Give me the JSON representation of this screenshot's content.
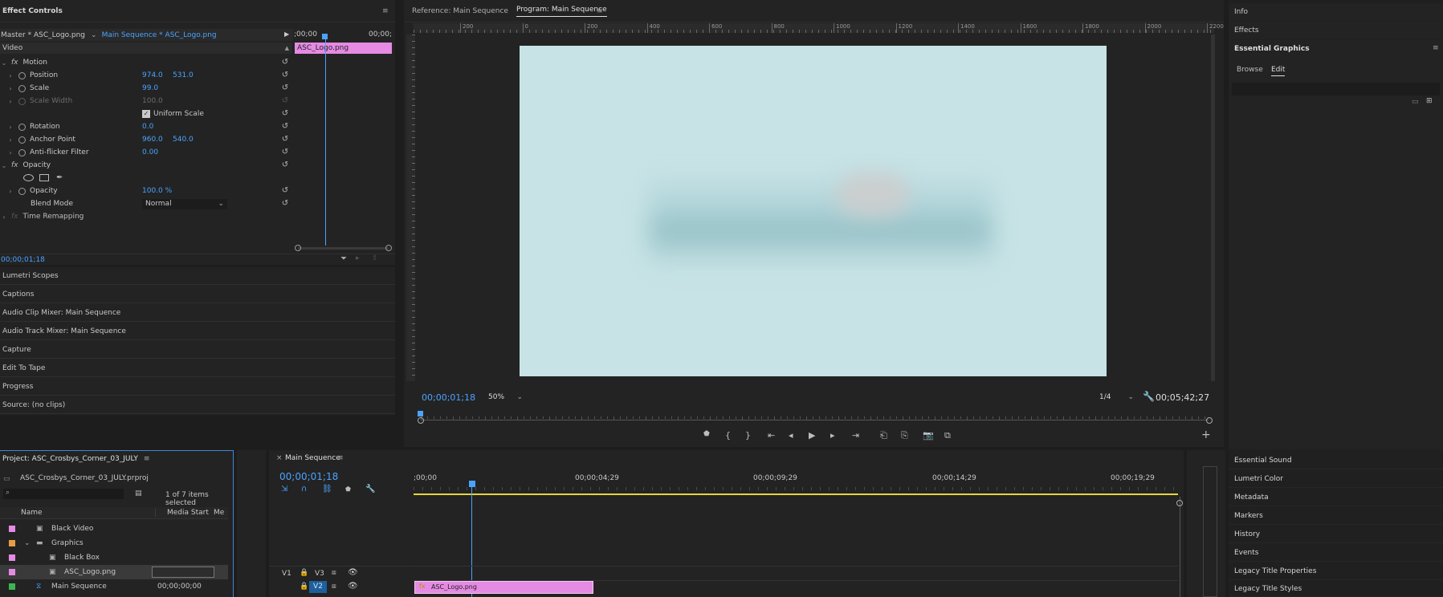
{
  "effect_controls": {
    "title": "Effect Controls",
    "source_master": "Master * ASC_Logo.png",
    "source_sequence": "Main Sequence * ASC_Logo.png",
    "time_start": ";00;00",
    "time_end": "00;00;",
    "clip_label": "ASC_Logo.png",
    "video_label": "Video",
    "motion_label": "Motion",
    "position_label": "Position",
    "position_x": "974.0",
    "position_y": "531.0",
    "scale_label": "Scale",
    "scale_value": "99.0",
    "scale_width_label": "Scale Width",
    "scale_width_value": "100.0",
    "uniform_scale_label": "Uniform Scale",
    "rotation_label": "Rotation",
    "rotation_value": "0.0",
    "anchor_label": "Anchor Point",
    "anchor_x": "960.0",
    "anchor_y": "540.0",
    "antiflicker_label": "Anti-flicker Filter",
    "antiflicker_value": "0.00",
    "opacity_group_label": "Opacity",
    "opacity_label": "Opacity",
    "opacity_value": "100.0 %",
    "blend_label": "Blend Mode",
    "blend_value": "Normal",
    "time_remap_label": "Time Remapping",
    "timecode": "00;00;01;18"
  },
  "left_panels": [
    "Lumetri Scopes",
    "Captions",
    "Audio Clip Mixer: Main Sequence",
    "Audio Track Mixer: Main Sequence",
    "Capture",
    "Edit To Tape",
    "Progress",
    "Source: (no clips)"
  ],
  "program": {
    "tab_reference": "Reference: Main Sequence",
    "tab_program": "Program: Main Sequence",
    "ruler_labels": [
      "200",
      "0",
      "200",
      "400",
      "600",
      "800",
      "1000",
      "1200",
      "1400",
      "1600",
      "1800",
      "2000",
      "2200"
    ],
    "timecode": "00;00;01;18",
    "zoom": "50%",
    "resolution": "1/4",
    "duration": "00;05;42;27"
  },
  "right_panel": {
    "info": "Info",
    "effects": "Effects",
    "essential_graphics": "Essential Graphics",
    "tab_browse": "Browse",
    "tab_edit": "Edit",
    "bottom_items": [
      "Essential Sound",
      "Lumetri Color",
      "Metadata",
      "Markers",
      "History",
      "Events",
      "Legacy Title Properties",
      "Legacy Title Styles"
    ]
  },
  "project": {
    "title": "Project: ASC_Crosbys_Corner_03_JULY",
    "filename": "ASC_Crosbys_Corner_03_JULY.prproj",
    "selection_count": "1 of 7 items selected",
    "col_name": "Name",
    "col_media_start": "Media Start",
    "col_more": "Me",
    "items": [
      {
        "name": "Black Video",
        "color": "#e58be3",
        "start": ""
      },
      {
        "name": "Graphics",
        "color": "#e89c45",
        "start": ""
      },
      {
        "name": "Black Box",
        "color": "#e58be3",
        "start": ""
      },
      {
        "name": "ASC_Logo.png",
        "color": "#e58be3",
        "start": ""
      },
      {
        "name": "Main Sequence",
        "color": "#3bb552",
        "start": "00;00;00;00"
      }
    ]
  },
  "timeline": {
    "tab": "Main Sequence",
    "timecode": "00;00;01;18",
    "ruler": [
      ";00;00",
      "00;00;04;29",
      "00;00;09;29",
      "00;00;14;29",
      "00;00;19;29"
    ],
    "track_v3": "V3",
    "track_v2": "V2",
    "track_v1": "V1",
    "clip_label": "ASC_Logo.png"
  },
  "colors": {
    "accent_blue": "#4aa3ff",
    "clip_pink": "#e58be3",
    "frame_bg": "#c7e3e6",
    "work_area": "#e6d63c"
  }
}
